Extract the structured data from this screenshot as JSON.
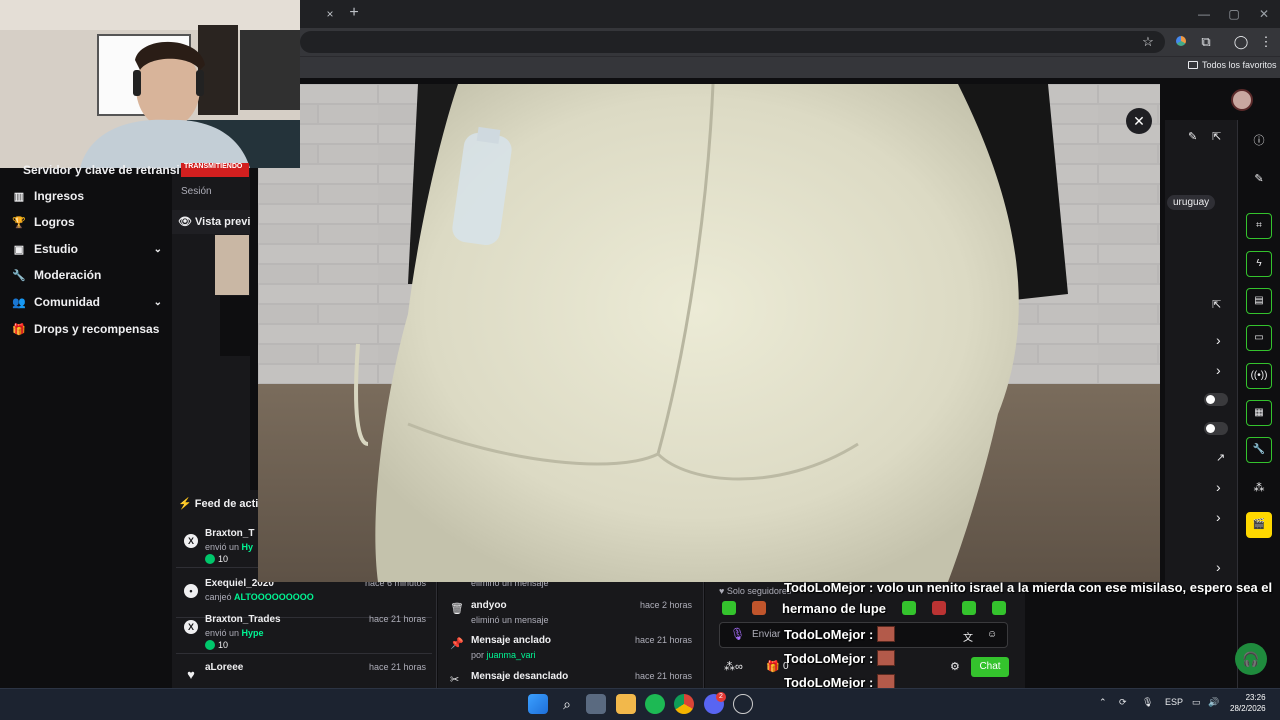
{
  "browser": {
    "tab_close": "×",
    "new_tab": "+",
    "window_min": "—",
    "window_max": "▢",
    "window_close": "✕",
    "bookmarks_all": "Todos los favoritos"
  },
  "webcam": {
    "caption": "Servidor y clave de retransi",
    "tag": "TRANSMITIENDO"
  },
  "sidebar": {
    "session": "Sesión",
    "preview": "Vista previa",
    "items": [
      {
        "label": "Ingresos",
        "icon": "▥"
      },
      {
        "label": "Logros",
        "icon": "🏆"
      },
      {
        "label": "Estudio",
        "icon": "▣",
        "chevron": "⌄"
      },
      {
        "label": "Moderación",
        "icon": "🔧"
      },
      {
        "label": "Comunidad",
        "icon": "👥",
        "chevron": "⌄"
      },
      {
        "label": "Drops y recompensas",
        "icon": "🎁"
      }
    ]
  },
  "feed": {
    "title": "Feed de acti",
    "items": [
      {
        "user": "Braxton_T",
        "time": "",
        "desc_prefix": "envió un",
        "desc_highlight": "Hy",
        "amount": "10",
        "icon": "X"
      },
      {
        "user": "Exequiel_2020",
        "time": "hace 6 minutos",
        "desc_prefix": "canjeó",
        "desc_highlight": "ALTOOOOOOOOO",
        "amount": "",
        "icon": "•"
      },
      {
        "user": "Braxton_Trades",
        "time": "hace 21 horas",
        "desc_prefix": "envió un",
        "desc_highlight": "Hype",
        "amount": "10",
        "icon": "X"
      },
      {
        "user": "aLoreee",
        "time": "hace 21 horas",
        "desc_prefix": "",
        "desc_highlight": "",
        "amount": "",
        "icon": "♥"
      }
    ]
  },
  "modlog": {
    "top_desc": "eliminó un mensaje",
    "rows": [
      {
        "title": "andyoo",
        "sub": "eliminó un mensaje",
        "sub_user": "",
        "time": "hace 2 horas",
        "icon": "🗑"
      },
      {
        "title": "Mensaje anclado",
        "sub": "por",
        "sub_user": "juanma_vari",
        "time": "hace 21 horas",
        "icon": "📌"
      },
      {
        "title": "Mensaje desanclado",
        "sub": "",
        "sub_user": "",
        "time": "hace 21 horas",
        "icon": "✂"
      }
    ]
  },
  "chat": {
    "mode": "Solo seguidores",
    "input_placeholder": "Enviar",
    "send_label": "Chat",
    "points": "0"
  },
  "right_panel": {
    "tag": "uruguay"
  },
  "overlay_messages": [
    {
      "user": "TodoLoMejor",
      "text": "volo un nenito israel a la mierda con ese misilaso, espero sea el"
    },
    {
      "user": "",
      "text": "hermano de lupe"
    },
    {
      "user": "TodoLoMejor",
      "text": ""
    },
    {
      "user": "TodoLoMejor",
      "text": ""
    },
    {
      "user": "TodoLoMejor",
      "text": ""
    }
  ],
  "taskbar": {
    "lang": "ESP",
    "time": "23:26",
    "date": "28/2/2026",
    "notif_badge": "2"
  },
  "colors": {
    "twitch_green": "#34c32d",
    "bg": "#0e0e10",
    "panel": "#18181b"
  }
}
